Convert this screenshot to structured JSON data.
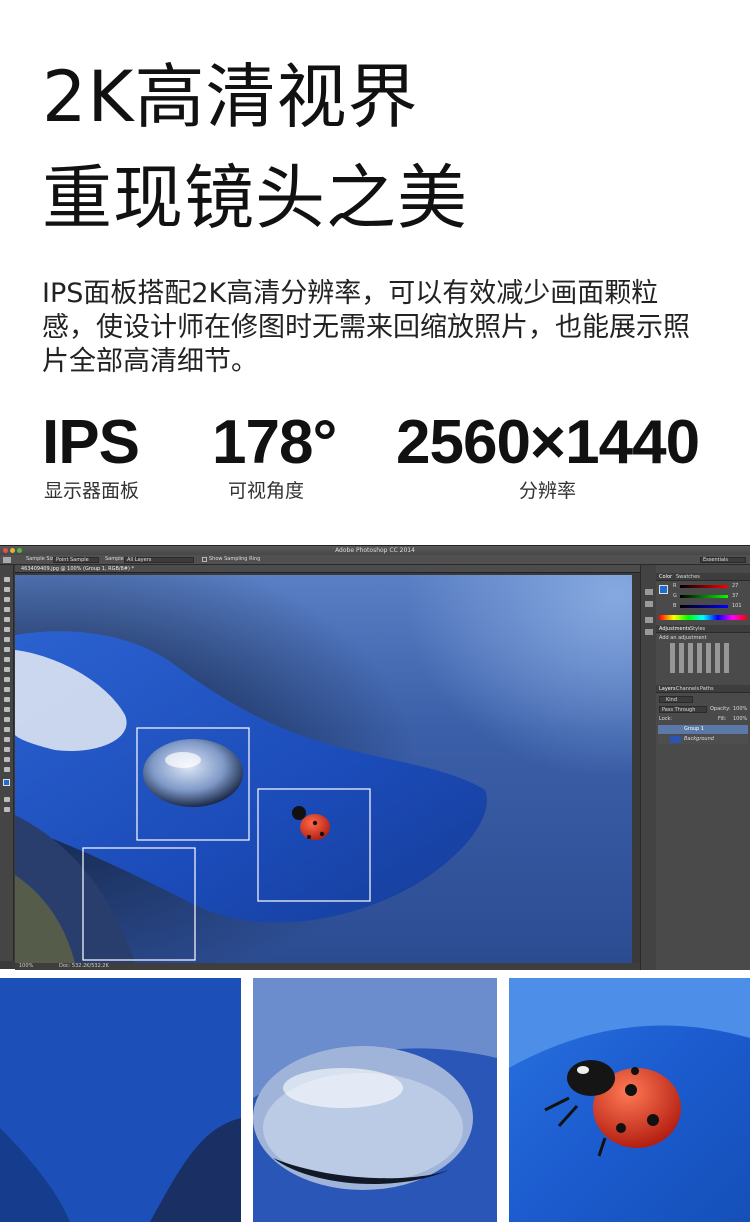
{
  "headline": {
    "line1": "2K高清视界",
    "line2": "重现镜头之美"
  },
  "description": "IPS面板搭配2K高清分辨率，可以有效减少画面颗粒感，使设计师在修图时无需来回缩放照片，也能展示照片全部高清细节。",
  "specs": [
    {
      "value": "IPS",
      "label": "显示器面板"
    },
    {
      "value": "178°",
      "label": "可视角度"
    },
    {
      "value": "2560×1440",
      "label": "分辨率"
    }
  ],
  "photoshop": {
    "window_title": "Adobe Photoshop CC 2014",
    "options": {
      "sample_size_label": "Sample Size:",
      "sample_size_value": "Point Sample",
      "sample_label": "Sample:",
      "sample_value": "All Layers",
      "show_ring_label": "Show Sampling Ring",
      "workspace": "Essentials"
    },
    "document_tab": "463409409.jpg @ 100% (Group 1, RGB/8#) *",
    "status": {
      "zoom": "100%",
      "doc": "Doc: 532.2K/532.2K"
    },
    "panels": {
      "color_tab": "Color",
      "swatches_tab": "Swatches",
      "rgb": [
        {
          "channel": "R",
          "value": "27"
        },
        {
          "channel": "G",
          "value": "37"
        },
        {
          "channel": "B",
          "value": "101"
        }
      ],
      "adjustments_tab": "Adjustments",
      "styles_tab": "Styles",
      "add_adjustment": "Add an adjustment",
      "layers_tab": "Layers",
      "channels_tab": "Channels",
      "paths_tab": "Paths",
      "kind": "Kind",
      "blend_mode": "Pass Through",
      "opacity_label": "Opacity:",
      "opacity_value": "100%",
      "lock_label": "Lock:",
      "fill_label": "Fill:",
      "fill_value": "100%",
      "layers": [
        {
          "name": "Group 1"
        },
        {
          "name": "Background"
        }
      ]
    }
  },
  "colors": {
    "accent_blue": "#1e4fb0",
    "ladybug_red": "#d8321c",
    "ps_background": "#3a3a3a"
  }
}
